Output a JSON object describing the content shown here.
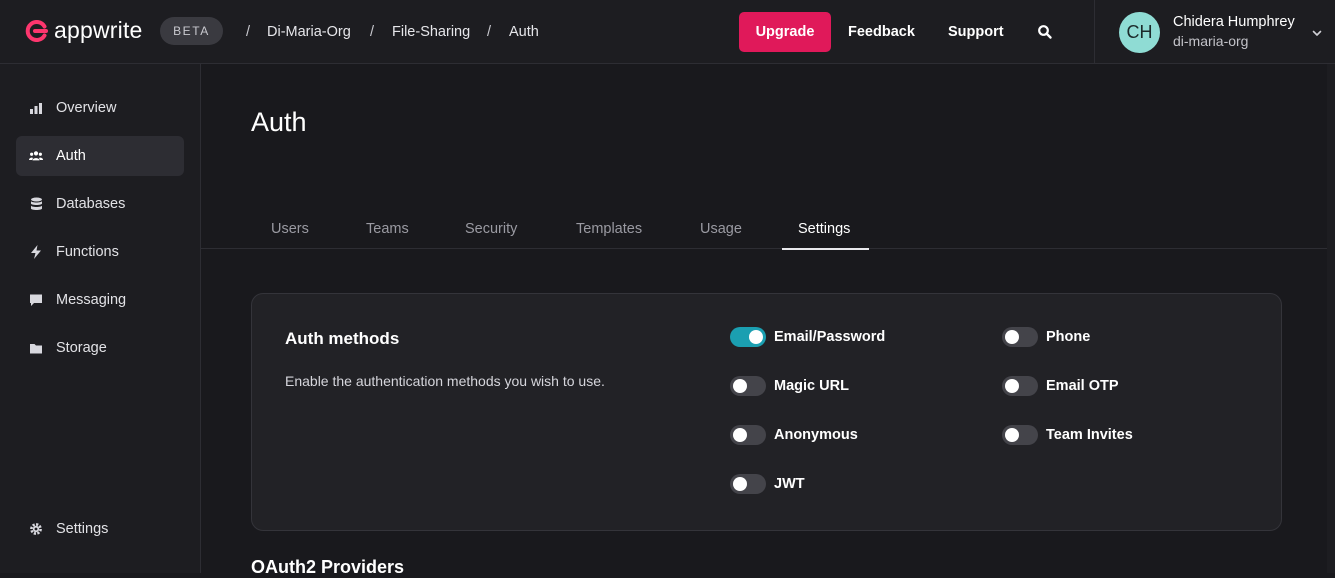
{
  "header": {
    "brand": "appwrite",
    "badge": "BETA",
    "breadcrumbs": [
      "Di-Maria-Org",
      "File-Sharing",
      "Auth"
    ],
    "upgrade_label": "Upgrade",
    "feedback_label": "Feedback",
    "support_label": "Support",
    "user": {
      "initials": "CH",
      "name": "Chidera Humphrey",
      "org": "di-maria-org"
    }
  },
  "sidebar": {
    "items": [
      {
        "label": "Overview",
        "icon": "bar-chart-icon",
        "active": false
      },
      {
        "label": "Auth",
        "icon": "users-icon",
        "active": true
      },
      {
        "label": "Databases",
        "icon": "database-icon",
        "active": false
      },
      {
        "label": "Functions",
        "icon": "lightning-icon",
        "active": false
      },
      {
        "label": "Messaging",
        "icon": "chat-icon",
        "active": false
      },
      {
        "label": "Storage",
        "icon": "folder-icon",
        "active": false
      }
    ],
    "settings_label": "Settings"
  },
  "main": {
    "title": "Auth",
    "tabs": [
      "Users",
      "Teams",
      "Security",
      "Templates",
      "Usage",
      "Settings"
    ],
    "active_tab": "Settings",
    "auth_methods": {
      "title": "Auth methods",
      "description": "Enable the authentication methods you wish to use.",
      "methods": [
        {
          "label": "Email/Password",
          "enabled": true
        },
        {
          "label": "Phone",
          "enabled": false
        },
        {
          "label": "Magic URL",
          "enabled": false
        },
        {
          "label": "Email OTP",
          "enabled": false
        },
        {
          "label": "Anonymous",
          "enabled": false
        },
        {
          "label": "Team Invites",
          "enabled": false
        },
        {
          "label": "JWT",
          "enabled": false
        }
      ]
    },
    "next_section_title": "OAuth2 Providers"
  },
  "colors": {
    "accent": "#e0195a",
    "toggle_on": "#1b9fb1",
    "avatar": "#8fdcd4"
  }
}
